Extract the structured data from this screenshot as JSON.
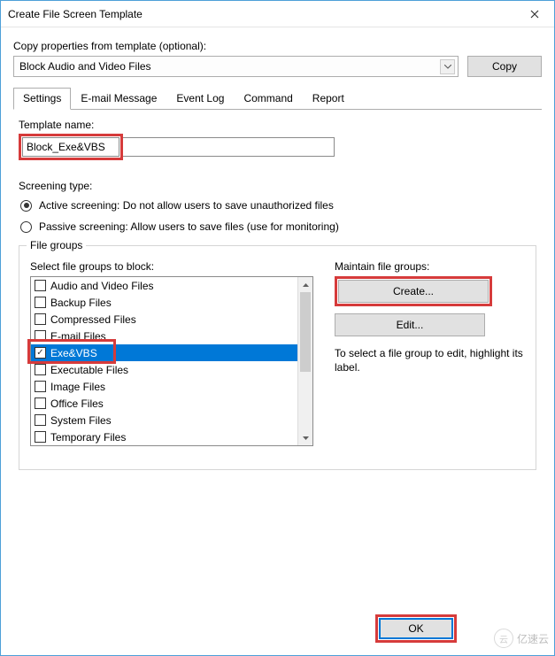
{
  "title": "Create File Screen Template",
  "copy_section": {
    "label": "Copy properties from template (optional):",
    "dropdown_value": "Block Audio and Video Files",
    "copy_btn": "Copy"
  },
  "tabs": [
    "Settings",
    "E-mail Message",
    "Event Log",
    "Command",
    "Report"
  ],
  "template_name_label": "Template name:",
  "template_name_value": "Block_Exe&VBS",
  "screening": {
    "label": "Screening type:",
    "active": "Active screening: Do not allow users to save unauthorized files",
    "passive": "Passive screening: Allow users to save files (use for monitoring)"
  },
  "file_groups": {
    "legend": "File groups",
    "select_label": "Select file groups to block:",
    "items": [
      {
        "label": "Audio and Video Files",
        "checked": false,
        "selected": false
      },
      {
        "label": "Backup Files",
        "checked": false,
        "selected": false
      },
      {
        "label": "Compressed Files",
        "checked": false,
        "selected": false
      },
      {
        "label": "E-mail Files",
        "checked": false,
        "selected": false
      },
      {
        "label": "Exe&VBS",
        "checked": true,
        "selected": true
      },
      {
        "label": "Executable Files",
        "checked": false,
        "selected": false
      },
      {
        "label": "Image Files",
        "checked": false,
        "selected": false
      },
      {
        "label": "Office Files",
        "checked": false,
        "selected": false
      },
      {
        "label": "System Files",
        "checked": false,
        "selected": false
      },
      {
        "label": "Temporary Files",
        "checked": false,
        "selected": false
      }
    ],
    "maintain_label": "Maintain file groups:",
    "create_btn": "Create...",
    "edit_btn": "Edit...",
    "hint": "To select a file group to edit, highlight its label."
  },
  "buttons": {
    "ok": "OK"
  },
  "watermark": "亿速云"
}
